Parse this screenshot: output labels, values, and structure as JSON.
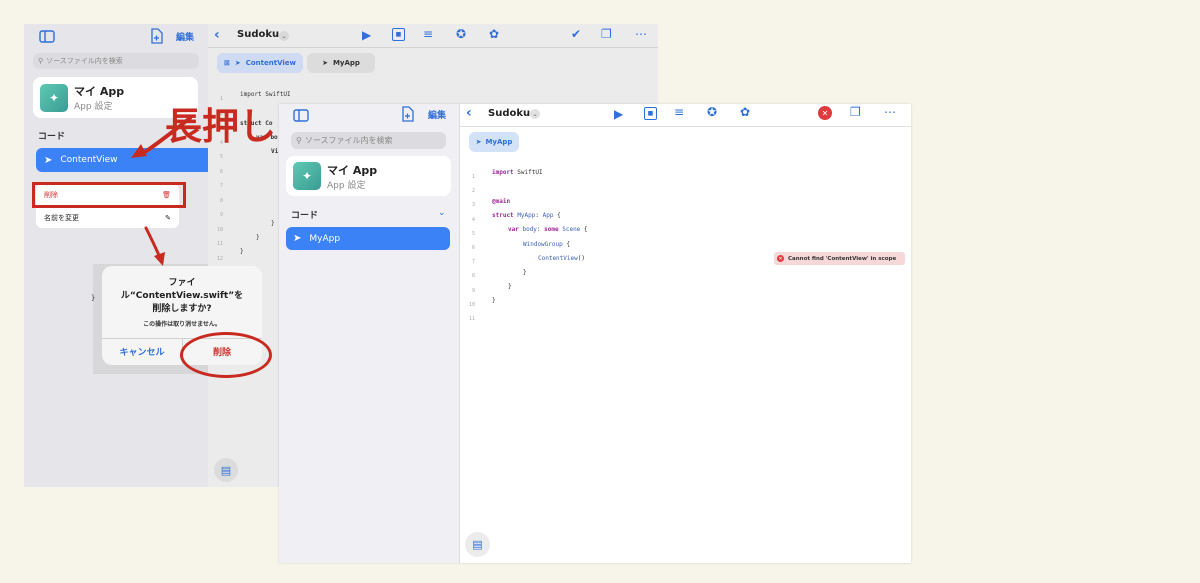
{
  "back": {
    "toolbar": {
      "edit": "編集",
      "title": "Sudoku"
    },
    "search_placeholder": "ソースファイル内を検索",
    "app": {
      "name": "マイ App",
      "sub": "App 設定"
    },
    "section": "コード",
    "selected_file": "ContentView",
    "menu": {
      "delete": "削除",
      "rename": "名前を変更"
    },
    "tabs": [
      "ContentView",
      "MyApp"
    ],
    "code": [
      "import SwiftUI",
      "struct Co",
      "var bo",
      "Vi",
      "}",
      "}",
      "}"
    ],
    "line_numbers": [
      "1",
      "2",
      "3",
      "4",
      "5",
      "6",
      "7",
      "8",
      "9",
      "10",
      "11",
      "12"
    ],
    "dialog": {
      "title_1": "ファイ",
      "title_2": "ル“ContentView.swift”を",
      "title_3": "削除しますか?",
      "message": "この操作は取り消せません。",
      "cancel": "キャンセル",
      "delete": "削除"
    },
    "stray_brace": "}"
  },
  "annotation": {
    "long_press": "長押し"
  },
  "front": {
    "toolbar": {
      "edit": "編集",
      "title": "Sudoku"
    },
    "search_placeholder": "ソースファイル内を検索",
    "app": {
      "name": "マイ App",
      "sub": "App 設定"
    },
    "section": "コード",
    "selected_file": "MyApp",
    "tab": "MyApp",
    "line_numbers": [
      "1",
      "2",
      "3",
      "4",
      "5",
      "6",
      "7",
      "8",
      "9",
      "10",
      "11"
    ],
    "error": "Cannot find 'ContentView' in scope"
  },
  "colors": {
    "accent": "#2f6fd8",
    "selection": "#3b82f6",
    "annotation_red": "#c92a1f",
    "error_bg": "#f6d8d8"
  }
}
